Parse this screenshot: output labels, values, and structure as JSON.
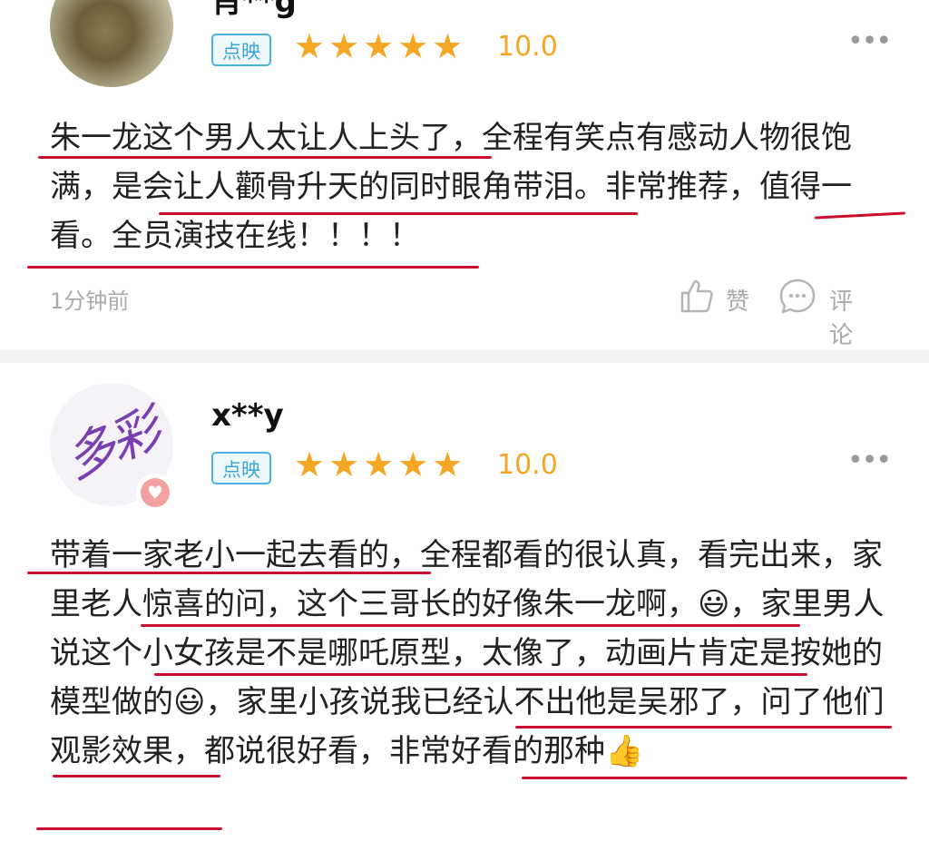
{
  "reviews": [
    {
      "username": "肖**g",
      "source": "点映",
      "stars": "★★★★★",
      "score": "10.0",
      "more": "•••",
      "content": "朱一龙这个男人太让人上头了，全程有笑点有感动人物很饱满，是会让人颧骨升天的同时眼角带泪。非常推荐，值得一看。全员演技在线！！！！",
      "time": "1分钟前",
      "like_label": "赞",
      "comment_label": "评论"
    },
    {
      "username": "x**y",
      "avatar_text": "多彩",
      "source": "点映",
      "stars": "★★★★★",
      "score": "10.0",
      "more": "•••",
      "content": "带着一家老小一起去看的，全程都看的很认真，看完出来，家里老人惊喜的问，这个三哥长的好像朱一龙啊，😃，家里男人说这个小女孩是不是哪吒原型，太像了，动画片肯定是按她的模型做的😃，家里小孩说我已经认不出他是吴邪了，问了他们观影效果，都说很好看，非常好看的那种👍"
    }
  ],
  "colors": {
    "star": "#f5a623",
    "badge_border": "#4ab3e0",
    "underline": "#c8102e"
  },
  "icons": [
    "thumbs-up-icon",
    "comment-icon",
    "more-icon",
    "heart-badge-icon"
  ]
}
